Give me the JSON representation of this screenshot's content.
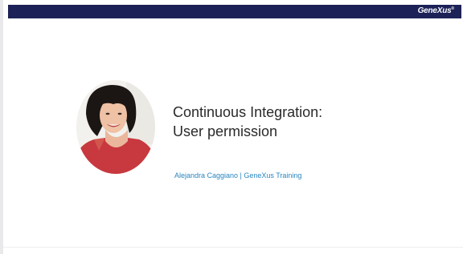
{
  "header": {
    "brand": "GeneXus",
    "brand_mark": "®",
    "bar_color": "#1c2257"
  },
  "slide": {
    "title_line1": "Continuous Integration:",
    "title_line2": "User permission",
    "byline": "Alejandra Caggiano | GeneXus Training",
    "byline_color": "#2a86bf",
    "speaker_photo": "speaker-portrait"
  }
}
